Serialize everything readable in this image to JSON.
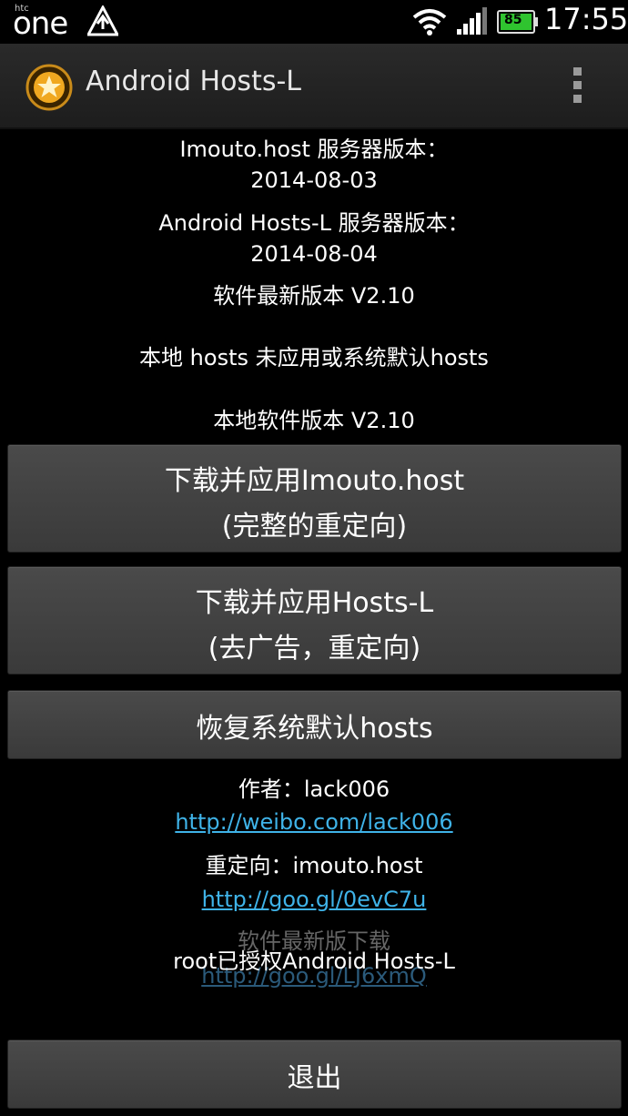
{
  "status_bar": {
    "brand_small": "htc",
    "brand": "one",
    "time": "17:55",
    "battery_level": "85",
    "icons": [
      "alert-triangle-icon",
      "wifi-icon",
      "signal-icon",
      "battery-icon"
    ]
  },
  "action_bar": {
    "title": "Android Hosts-L",
    "app_icon": "star-coin-icon",
    "menu_icon": "overflow-menu-icon"
  },
  "info": {
    "imouto_version_label": "Imouto.host 服务器版本：",
    "imouto_version_date": "2014-08-03",
    "hostsl_version_label": "Android Hosts-L 服务器版本：",
    "hostsl_version_date": "2014-08-04",
    "latest_version": "软件最新版本 V2.10",
    "local_hosts_status": "本地 hosts 未应用或系统默认hosts",
    "local_version": "本地软件版本 V2.10"
  },
  "buttons": {
    "imouto_line1": "下载并应用Imouto.host",
    "imouto_line2": "(完整的重定向)",
    "hostsl_line1": "下载并应用Hosts-L",
    "hostsl_line2": "(去广告，重定向)",
    "restore": "恢复系统默认hosts",
    "exit": "退出"
  },
  "credits": {
    "author": "作者：lack006",
    "author_link": "http://weibo.com/lack006",
    "redirect": "重定向：imouto.host",
    "redirect_link": "http://goo.gl/0evC7u",
    "download_label": "软件最新版下载",
    "download_link": "http://goo.gl/LJ6xmQ",
    "toast": "root已授权Android Hosts-L"
  },
  "colors": {
    "link": "#3fb3e8",
    "battery_green": "#2fc42f",
    "button_bg": "#444444"
  }
}
